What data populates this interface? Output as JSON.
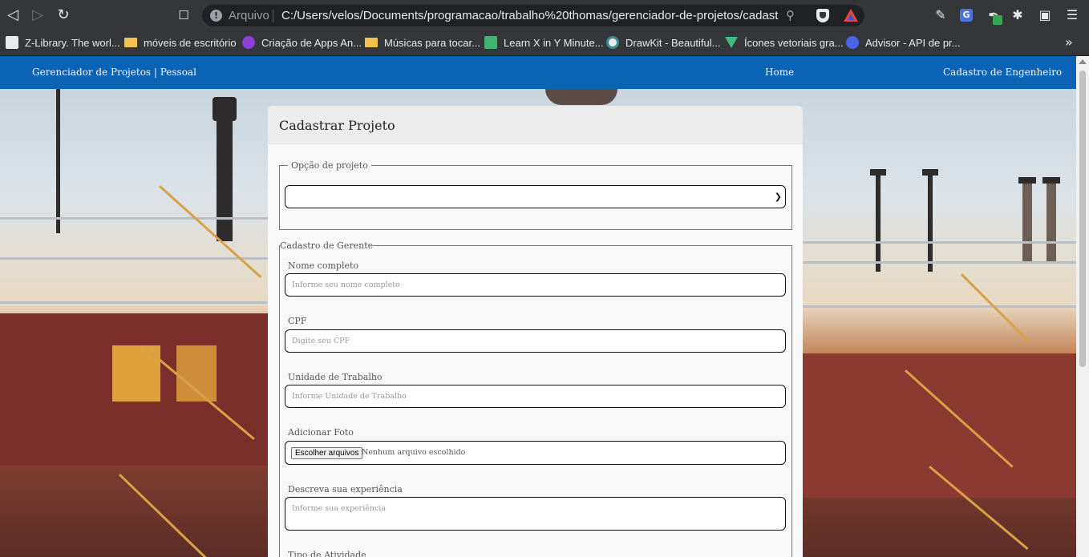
{
  "browser": {
    "address_prefix": "Arquivo",
    "url": "C:/Users/velos/Documents/programacao/trabalho%20thomas/gerenciador-de-projetos/cadastro_...",
    "bookmarks": [
      {
        "label": "Z-Library. The worl...",
        "icon": "zlibrary-icon"
      },
      {
        "label": "móveis de escritório",
        "icon": "folder-icon"
      },
      {
        "label": "Criação de Apps An...",
        "icon": "app-icon"
      },
      {
        "label": "Músicas para tocar...",
        "icon": "folder-icon"
      },
      {
        "label": "Learn X in Y Minute...",
        "icon": "learnx-icon"
      },
      {
        "label": "DrawKit - Beautiful...",
        "icon": "drawkit-icon"
      },
      {
        "label": "Ícones vetoriais gra...",
        "icon": "vue-icon"
      },
      {
        "label": "Advisor - API de pr...",
        "icon": "advisor-icon"
      }
    ]
  },
  "navbar": {
    "brand": "Gerenciador de Projetos | Pessoal",
    "links": [
      "Home",
      "Cadastro de Engenheiro"
    ],
    "color": "#0b63b6"
  },
  "form": {
    "title": "Cadastrar Projeto",
    "project_option_legend": "Opção de projeto",
    "project_option_value": "",
    "manager_legend": "Cadastro de Gerente",
    "fields": {
      "name": {
        "label": "Nome completo",
        "placeholder": "Informe seu nome completo"
      },
      "cpf": {
        "label": "CPF",
        "placeholder": "Digite seu CPF"
      },
      "unit": {
        "label": "Unidade de Trabalho",
        "placeholder": "Informe Unidade de Trabalho"
      },
      "photo": {
        "label": "Adicionar Foto",
        "button": "Escolher arquivos",
        "status": "Nenhum arquivo escolhido"
      },
      "experience": {
        "label": "Descreva sua experiência",
        "placeholder": "Informe sua experiência"
      },
      "activity": {
        "label": "Tipo de Atividade"
      }
    }
  }
}
